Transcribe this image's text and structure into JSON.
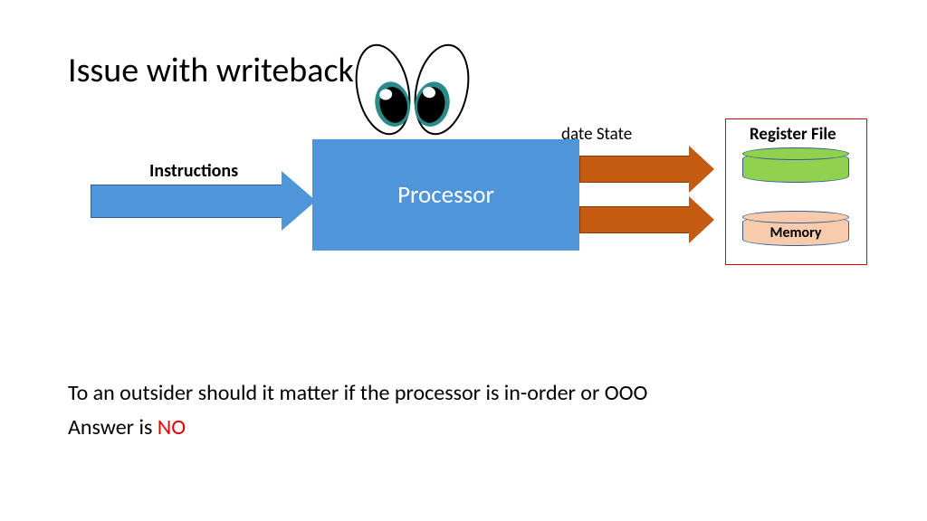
{
  "title": "Issue with writeback",
  "instructions_label": "Instructions",
  "processor_label": "Processor",
  "update_state_label": "date State",
  "register_file_label": "Register File",
  "memory_label": "Memory",
  "body_line1": "To an outsider should it matter if the processor is in-order or OOO",
  "body_line2a": "Answer is ",
  "body_line2b": "NO"
}
